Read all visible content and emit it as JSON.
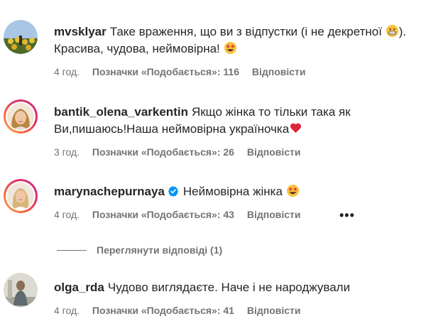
{
  "comments": [
    {
      "username": "mvsklyar",
      "text_before_emoji": "Таке враження, що ви з відпустки (і не декретної ",
      "emoji_1": "grinning-face-emoji",
      "text_after_emoji": "). Красива, чудова, неймовірна! ",
      "emoji_2": "star-struck-emoji",
      "time": "4 год.",
      "likes": "Позначки «Подобається»: 116",
      "reply": "Відповісти"
    },
    {
      "username": "bantik_olena_varkentin",
      "text": "Якщо жінка то тільки така як Ви,пишаюсь!Наша неймовірна україночка",
      "emoji": "red-heart-emoji",
      "time": "3 год.",
      "likes": "Позначки «Подобається»: 26",
      "reply": "Відповісти"
    },
    {
      "username": "marynachepurnaya",
      "verified": true,
      "text": "Неймовірна жінка ",
      "emoji": "star-struck-emoji",
      "time": "4 год.",
      "likes": "Позначки «Подобається»: 43",
      "reply": "Відповісти",
      "more": "•••",
      "view_replies": "Переглянути відповіді (1)"
    },
    {
      "username": "olga_rda",
      "text": "Чудово виглядаєте. Наче і не народжували",
      "time": "4 год.",
      "likes": "Позначки «Подобається»: 41",
      "reply": "Відповісти"
    }
  ],
  "colors": {
    "text": "#262626",
    "secondary": "#737373",
    "verified": "#0095f6",
    "story_ring": "#e1306c"
  }
}
